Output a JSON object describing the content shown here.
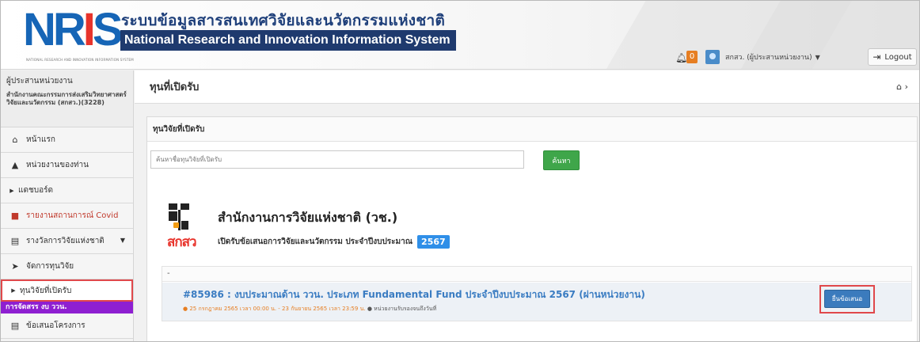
{
  "header": {
    "logo_text_nr": "NR",
    "logo_text_i": "I",
    "logo_text_s": "S",
    "logo_subtext": "NATIONAL RESEARCH AND INNOVATION INFORMATION SYSTEM",
    "title_th": "ระบบข้อมูลสารสนเทศวิจัยและนวัตกรรมแห่งชาติ",
    "title_en": "National Research and Innovation Information System",
    "notification_count": "0",
    "user_name": "สกสว. (ผู้ประสานหน่วยงาน)",
    "logout_label": "Logout"
  },
  "sidebar": {
    "role": "ผู้ประสานหน่วยงาน",
    "org": "สำนักงานคณะกรรมการส่งเสริมวิทยาศาสตร์ วิจัยและนวัตกรรม (สกสว.)(3228)",
    "items": [
      {
        "label": "หน้าแรก"
      },
      {
        "label": "หน่วยงานของท่าน"
      },
      {
        "label": "แดชบอร์ด"
      },
      {
        "label": "รายงานสถานการณ์ Covid"
      },
      {
        "label": "รางวัลการวิจัยแห่งชาติ"
      },
      {
        "label": "จัดการทุนวิจัย"
      },
      {
        "label": "ทุนวิจัยที่เปิดรับ"
      }
    ],
    "section_label": "การจัดสรร งบ ววน.",
    "last_item": "ข้อเสนอโครงการ"
  },
  "main": {
    "page_title": "ทุนที่เปิดรับ",
    "panel_title": "ทุนวิจัยที่เปิดรับ",
    "search_placeholder": "ค้นหาชื่อทุนวิจัยที่เปิดรับ",
    "search_button": "ค้นหา",
    "agency_logo_text": "สกสว",
    "agency_name": "สำนักงานการวิจัยแห่งชาติ (วช.)",
    "agency_sub": "เปิดรับข้อเสนอการวิจัยและนวัตกรรม ประจำปีงบประมาณ",
    "agency_year": "2567",
    "list_dash": "-",
    "fund_title": "#85986 : งบประมาณด้าน ววน. ประเภท Fundamental Fund ประจำปีงบประมาณ 2567 (ผ่านหน่วยงาน)",
    "fund_dates": "25 กรกฎาคม 2565 เวลา 00:00 น. - 23 กันยายน 2565 เวลา 23:59 น.",
    "fund_note": "หน่วยงานรับรองจนถึงวันที่",
    "submit_button": "ยื่นข้อเสนอ"
  },
  "colors": {
    "brand_blue": "#1665b6",
    "brand_red": "#e8332b",
    "title_bar_navy": "#1f3a6e",
    "search_green": "#3fa64a",
    "section_purple": "#8e1fd1",
    "submit_blue": "#3b7bbd",
    "highlight_red": "#e0484b",
    "year_badge": "#2f8fe8"
  },
  "icons": {
    "bell": "bell-icon",
    "home": "home-icon",
    "logout": "logout-icon"
  }
}
